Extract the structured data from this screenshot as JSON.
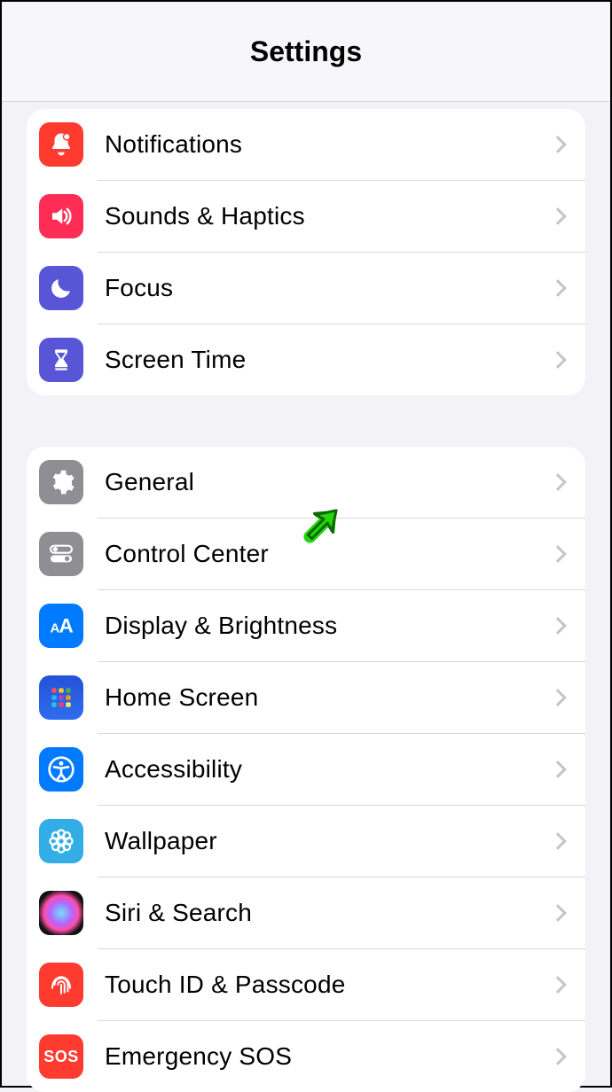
{
  "header": {
    "title": "Settings"
  },
  "groups": [
    {
      "items": [
        {
          "label": "Notifications",
          "icon": "bell-icon",
          "color": "bg-red"
        },
        {
          "label": "Sounds & Haptics",
          "icon": "speaker-icon",
          "color": "bg-pink"
        },
        {
          "label": "Focus",
          "icon": "moon-icon",
          "color": "bg-indigo"
        },
        {
          "label": "Screen Time",
          "icon": "hourglass-icon",
          "color": "bg-indigo"
        }
      ]
    },
    {
      "items": [
        {
          "label": "General",
          "icon": "gear-icon",
          "color": "bg-gray"
        },
        {
          "label": "Control Center",
          "icon": "toggles-icon",
          "color": "bg-gray"
        },
        {
          "label": "Display & Brightness",
          "icon": "text-size-icon",
          "color": "bg-blue"
        },
        {
          "label": "Home Screen",
          "icon": "apps-grid-icon",
          "color": "bg-blue"
        },
        {
          "label": "Accessibility",
          "icon": "accessibility-icon",
          "color": "bg-blue"
        },
        {
          "label": "Wallpaper",
          "icon": "flower-icon",
          "color": "bg-cyan"
        },
        {
          "label": "Siri & Search",
          "icon": "siri-icon",
          "color": "bg-black"
        },
        {
          "label": "Touch ID & Passcode",
          "icon": "fingerprint-icon",
          "color": "bg-red"
        },
        {
          "label": "Emergency SOS",
          "icon": "sos-icon",
          "color": "bg-red"
        }
      ]
    }
  ],
  "annotation": {
    "target": "Control Center"
  }
}
